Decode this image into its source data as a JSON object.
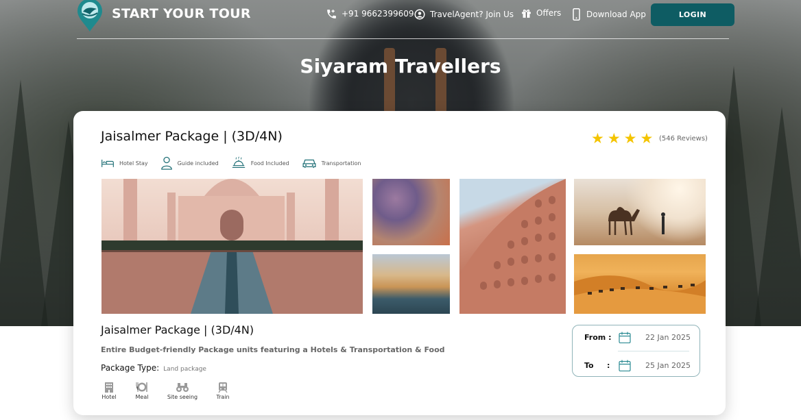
{
  "header": {
    "brand": "START YOUR TOUR",
    "phone": "+91 9662399609",
    "agent_link": "TravelAgent? Join Us",
    "offers": "Offers",
    "download": "Download App",
    "login": "LOGIN",
    "icons": [
      "phone-icon",
      "agent-icon",
      "gift-icon",
      "mobile-icon",
      "logo-pin-icon"
    ]
  },
  "page": {
    "title": "Siyaram Travellers"
  },
  "package": {
    "title": "Jaisalmer Package |  (3D/4N)",
    "rating_stars": 4,
    "star_color": "#f4c400",
    "reviews": "(546 Reviews)",
    "amenities": [
      {
        "label": "Hotel Stay",
        "icon": "bed-icon"
      },
      {
        "label": "Guide included",
        "icon": "person-icon"
      },
      {
        "label": "Food Included",
        "icon": "food-icon"
      },
      {
        "label": "Transportation",
        "icon": "car-icon"
      }
    ],
    "title_secondary": "Jaisalmer Package |  (3D/4N)",
    "description": "Entire Budget-friendly Package units featuring a Hotels & Transportation & Food",
    "type_label": "Package Type:",
    "type_value": "Land package",
    "services": [
      {
        "label": "Hotel",
        "icon": "building-icon"
      },
      {
        "label": "Meal",
        "icon": "meal-icon"
      },
      {
        "label": "Site seeing",
        "icon": "binoculars-icon"
      },
      {
        "label": "Train",
        "icon": "train-icon"
      }
    ],
    "dates": {
      "from_label": "From :",
      "from_value": "22 Jan 2025",
      "to_label": "To",
      "to_colon": ":",
      "to_value": "25 Jan 2025"
    }
  },
  "colors": {
    "accent": "#0e5c63",
    "date_border": "#8fb3b8"
  }
}
